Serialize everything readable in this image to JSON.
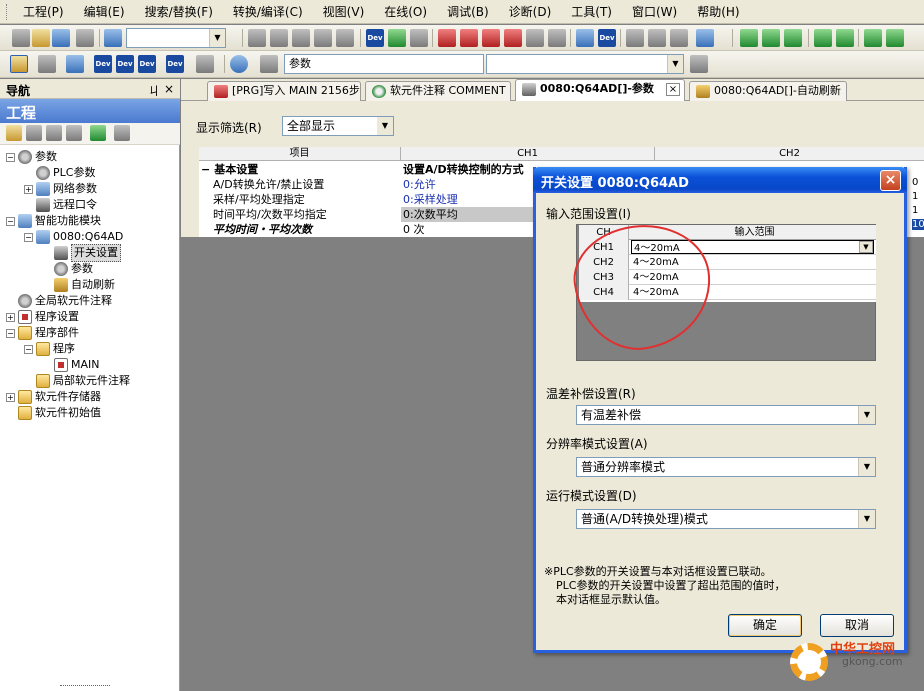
{
  "menu": [
    "工程(P)",
    "编辑(E)",
    "搜索/替换(F)",
    "转换/编译(C)",
    "视图(V)",
    "在线(O)",
    "调试(B)",
    "诊断(D)",
    "工具(T)",
    "窗口(W)",
    "帮助(H)"
  ],
  "toolbar": {
    "combo1_value": "",
    "combo2_value": "参数",
    "combo3_value": ""
  },
  "nav": {
    "header": "导航",
    "pin": "ㄐ",
    "close": "×",
    "project_title": "工程",
    "tree": [
      {
        "label": "参数",
        "level": 0,
        "expander": "−",
        "icon": "gear"
      },
      {
        "label": "PLC参数",
        "level": 1,
        "expander": "",
        "icon": "gear"
      },
      {
        "label": "网络参数",
        "level": 1,
        "expander": "+",
        "icon": "module"
      },
      {
        "label": "远程口令",
        "level": 1,
        "expander": "",
        "icon": "switch"
      },
      {
        "label": "智能功能模块",
        "level": 0,
        "expander": "−",
        "icon": "module"
      },
      {
        "label": "0080:Q64AD",
        "level": 1,
        "expander": "−",
        "icon": "module"
      },
      {
        "label": "开关设置",
        "level": 2,
        "expander": "",
        "icon": "switch",
        "selected": true
      },
      {
        "label": "参数",
        "level": 2,
        "expander": "",
        "icon": "gear"
      },
      {
        "label": "自动刷新",
        "level": 2,
        "expander": "",
        "icon": "dev"
      },
      {
        "label": "全局软元件注释",
        "level": 0,
        "expander": "",
        "icon": "gear"
      },
      {
        "label": "程序设置",
        "level": 0,
        "expander": "+",
        "icon": "prog"
      },
      {
        "label": "程序部件",
        "level": 0,
        "expander": "−",
        "icon": "folder"
      },
      {
        "label": "程序",
        "level": 1,
        "expander": "−",
        "icon": "folder"
      },
      {
        "label": "MAIN",
        "level": 2,
        "expander": "",
        "icon": "prog"
      },
      {
        "label": "局部软元件注释",
        "level": 1,
        "expander": "",
        "icon": "folder"
      },
      {
        "label": "软元件存储器",
        "level": 0,
        "expander": "+",
        "icon": "folder"
      },
      {
        "label": "软元件初始值",
        "level": 0,
        "expander": "",
        "icon": "folder"
      }
    ]
  },
  "tabs": [
    {
      "label": "[PRG]写入 MAIN 2156步",
      "active": false
    },
    {
      "label": "软元件注释 COMMENT",
      "active": false
    },
    {
      "label": "0080:Q64AD[]-参数",
      "active": true
    },
    {
      "label": "0080:Q64AD[]-自动刷新",
      "active": false
    }
  ],
  "tab_close": "×",
  "param": {
    "filter_label": "显示筛选(R)",
    "filter_value": "全部显示",
    "headers": {
      "item": "项目",
      "ch1": "CH1",
      "ch2": "CH2"
    },
    "rows": [
      {
        "item": "基本设置",
        "value": "设置A/D转换控制的方式",
        "bold": true,
        "expander": "−"
      },
      {
        "item": "A/D转换允许/禁止设置",
        "value": "0:允许",
        "blue": true
      },
      {
        "item": "采样/平均处理指定",
        "value": "0:采样处理",
        "blue": true
      },
      {
        "item": "时间平均/次数平均指定",
        "value": "0:次数平均",
        "shaded": true
      },
      {
        "item": "平均时间・平均次数",
        "value": "0 次",
        "italic": true
      }
    ],
    "right_edge": [
      "0",
      "1",
      "1",
      "10"
    ]
  },
  "dialog": {
    "title": "开关设置  0080:Q64AD",
    "close": "×",
    "input_range_label": "输入范围设置(I)",
    "table_headers": {
      "ch": "CH",
      "range": "输入范围"
    },
    "channels": [
      {
        "ch": "CH1",
        "range": "4～20mA"
      },
      {
        "ch": "CH2",
        "range": "4～20mA"
      },
      {
        "ch": "CH3",
        "range": "4～20mA"
      },
      {
        "ch": "CH4",
        "range": "4～20mA"
      }
    ],
    "temp_label": "温差补偿设置(R)",
    "temp_value": "有温差补偿",
    "resolution_label": "分辨率模式设置(A)",
    "resolution_value": "普通分辨率模式",
    "mode_label": "运行模式设置(D)",
    "mode_value": "普通(A/D转换处理)模式",
    "note_lines": [
      "※PLC参数的开关设置与本对话框设置已联动。",
      "PLC参数的开关设置中设置了超出范围的值时，",
      "本对话框显示默认值。"
    ],
    "ok": "确定",
    "cancel": "取消"
  },
  "watermark": {
    "text": "中华工控网",
    "url": "gkong.com"
  }
}
